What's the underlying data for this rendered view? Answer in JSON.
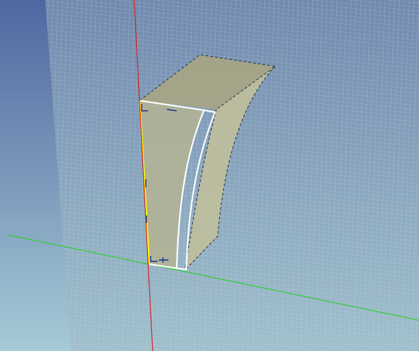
{
  "viewport": {
    "background_top": "#4f67a0",
    "background_bottom": "#a6cad6",
    "grid_plane_color": "#98b4c0",
    "grid_line_color": "#c8d4dc",
    "axes": {
      "x_axis_color": "#2bd12b",
      "y_axis_color": "#d21f1f"
    },
    "part": {
      "face_color": "#b3b394",
      "top_face_color": "#a6a584",
      "side_face_color": "#c0bf9c",
      "selected_edge_color": "#ffff00",
      "highlight_edge_color": "#ffffff",
      "hidden_edge_color": "#1f2a3a",
      "constraint_marker_color": "#142a8c"
    }
  }
}
